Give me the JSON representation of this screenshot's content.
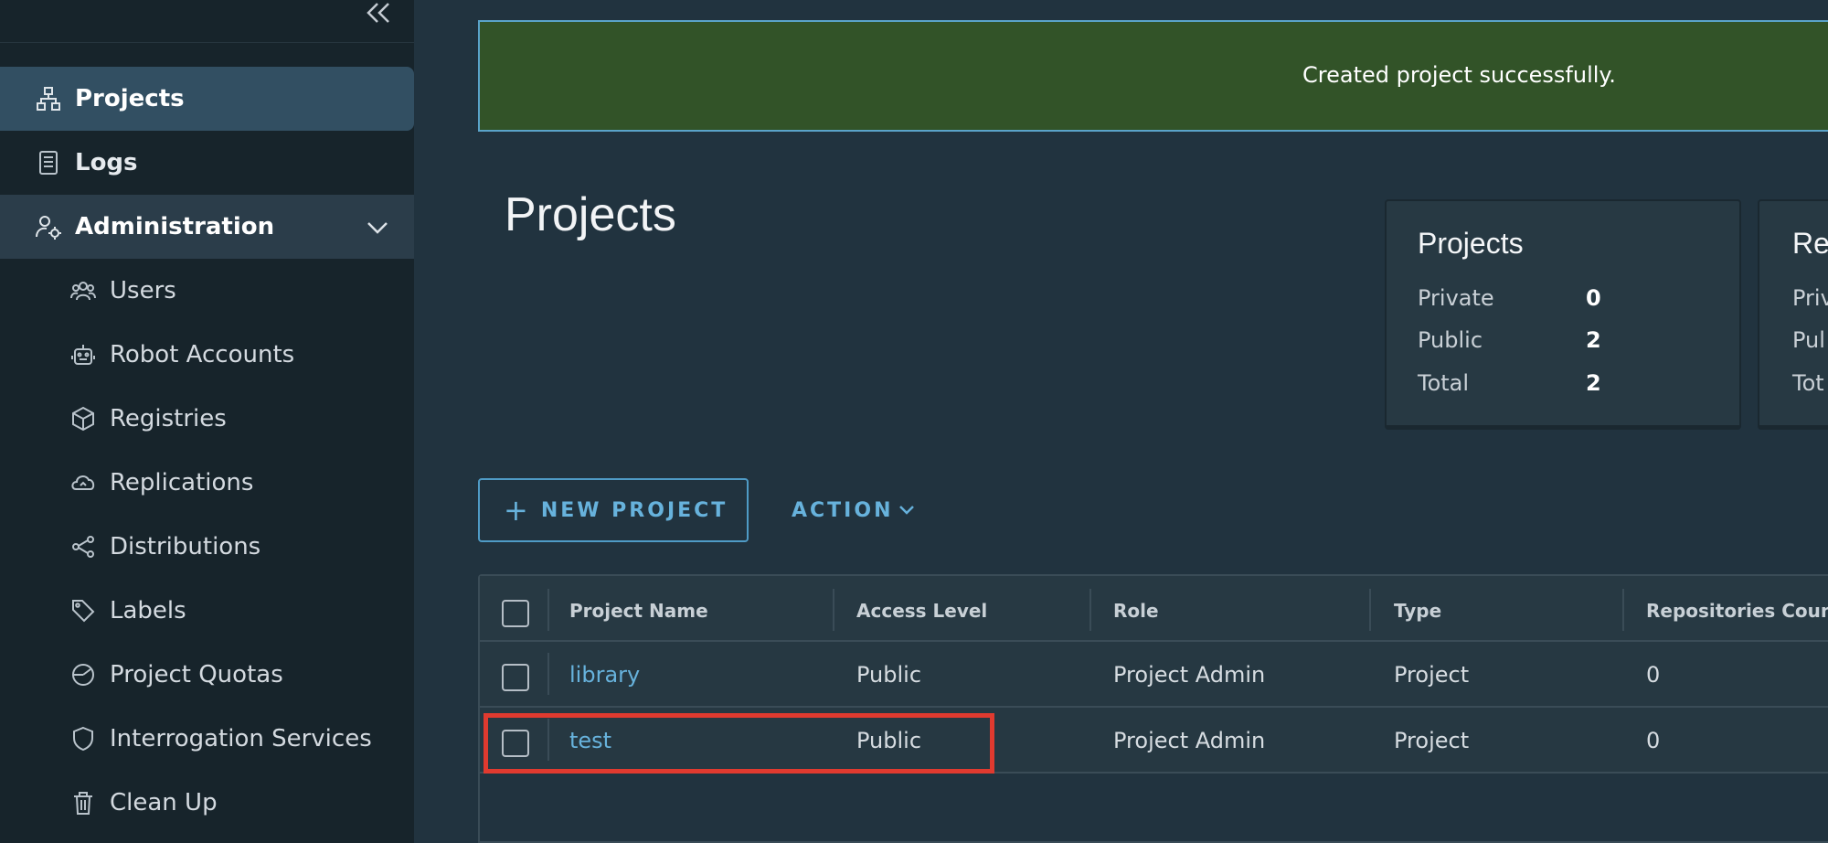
{
  "sidebar": {
    "items": [
      {
        "label": "Projects",
        "icon": "projects-icon"
      },
      {
        "label": "Logs",
        "icon": "logs-icon"
      },
      {
        "label": "Administration",
        "icon": "administration-icon"
      },
      {
        "label": "Users",
        "icon": "users-icon"
      },
      {
        "label": "Robot Accounts",
        "icon": "robot-icon"
      },
      {
        "label": "Registries",
        "icon": "registries-icon"
      },
      {
        "label": "Replications",
        "icon": "replications-icon"
      },
      {
        "label": "Distributions",
        "icon": "distributions-icon"
      },
      {
        "label": "Labels",
        "icon": "labels-icon"
      },
      {
        "label": "Project Quotas",
        "icon": "quotas-icon"
      },
      {
        "label": "Interrogation Services",
        "icon": "shield-icon"
      },
      {
        "label": "Clean Up",
        "icon": "trash-icon"
      }
    ]
  },
  "banner": {
    "message": "Created project successfully."
  },
  "page": {
    "title": "Projects"
  },
  "cards": [
    {
      "title": "Projects",
      "rows": [
        {
          "label": "Private",
          "value": "0"
        },
        {
          "label": "Public",
          "value": "2"
        },
        {
          "label": "Total",
          "value": "2"
        }
      ]
    },
    {
      "title": "Re",
      "rows": [
        {
          "label": "Priv",
          "value": ""
        },
        {
          "label": "Pul",
          "value": ""
        },
        {
          "label": "Tot",
          "value": ""
        }
      ]
    }
  ],
  "toolbar": {
    "new_project_label": "NEW PROJECT",
    "action_label": "ACTION"
  },
  "table": {
    "headers": [
      "Project Name",
      "Access Level",
      "Role",
      "Type",
      "Repositories Coun"
    ],
    "rows": [
      {
        "name": "library",
        "access": "Public",
        "role": "Project Admin",
        "type": "Project",
        "repos": "0"
      },
      {
        "name": "test",
        "access": "Public",
        "role": "Project Admin",
        "type": "Project",
        "repos": "0"
      }
    ]
  },
  "colors": {
    "accent": "#67b2dc",
    "success_bg": "#325328",
    "highlight": "#e03a2f"
  }
}
